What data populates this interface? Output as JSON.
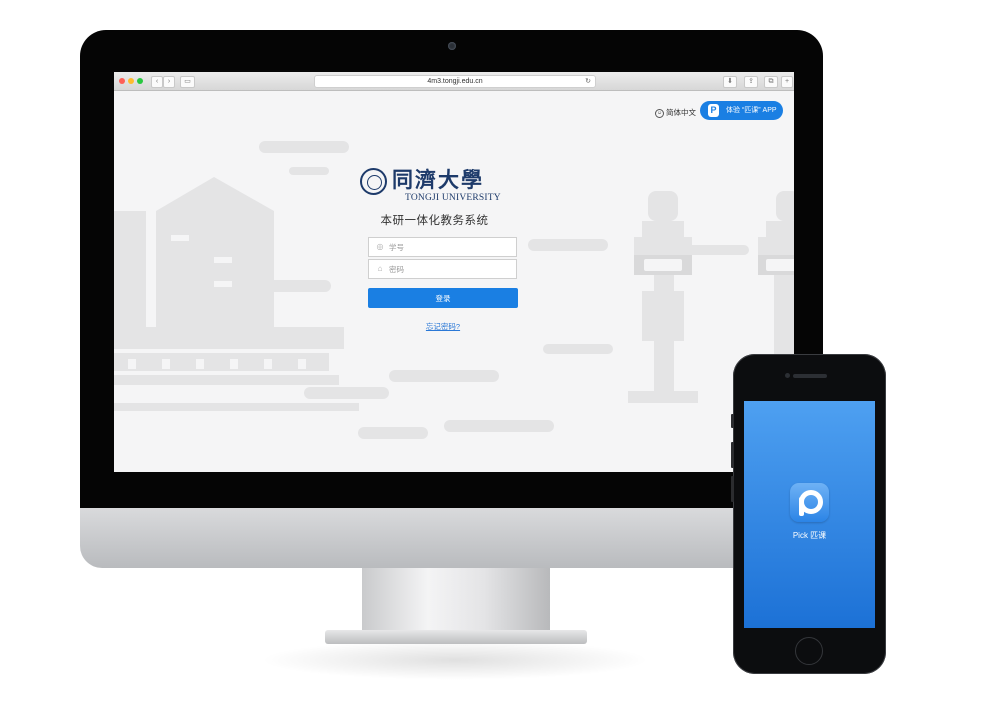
{
  "browser": {
    "url": "4m3.tongji.edu.cn"
  },
  "header": {
    "language": "简体中文",
    "app_promo": "体验 “匹课” APP"
  },
  "logo": {
    "name_cn": "同濟大學",
    "name_en": "TONGJI UNIVERSITY"
  },
  "system_title": "本研一体化教务系统",
  "login_form": {
    "student_id_placeholder": "学号",
    "password_placeholder": "密码",
    "submit_label": "登录",
    "forgot_password": "忘记密码?"
  },
  "phone_app": {
    "name": "Pick 匹课"
  },
  "colors": {
    "accent": "#1a7fe3",
    "logo_navy": "#1d3a6a"
  }
}
